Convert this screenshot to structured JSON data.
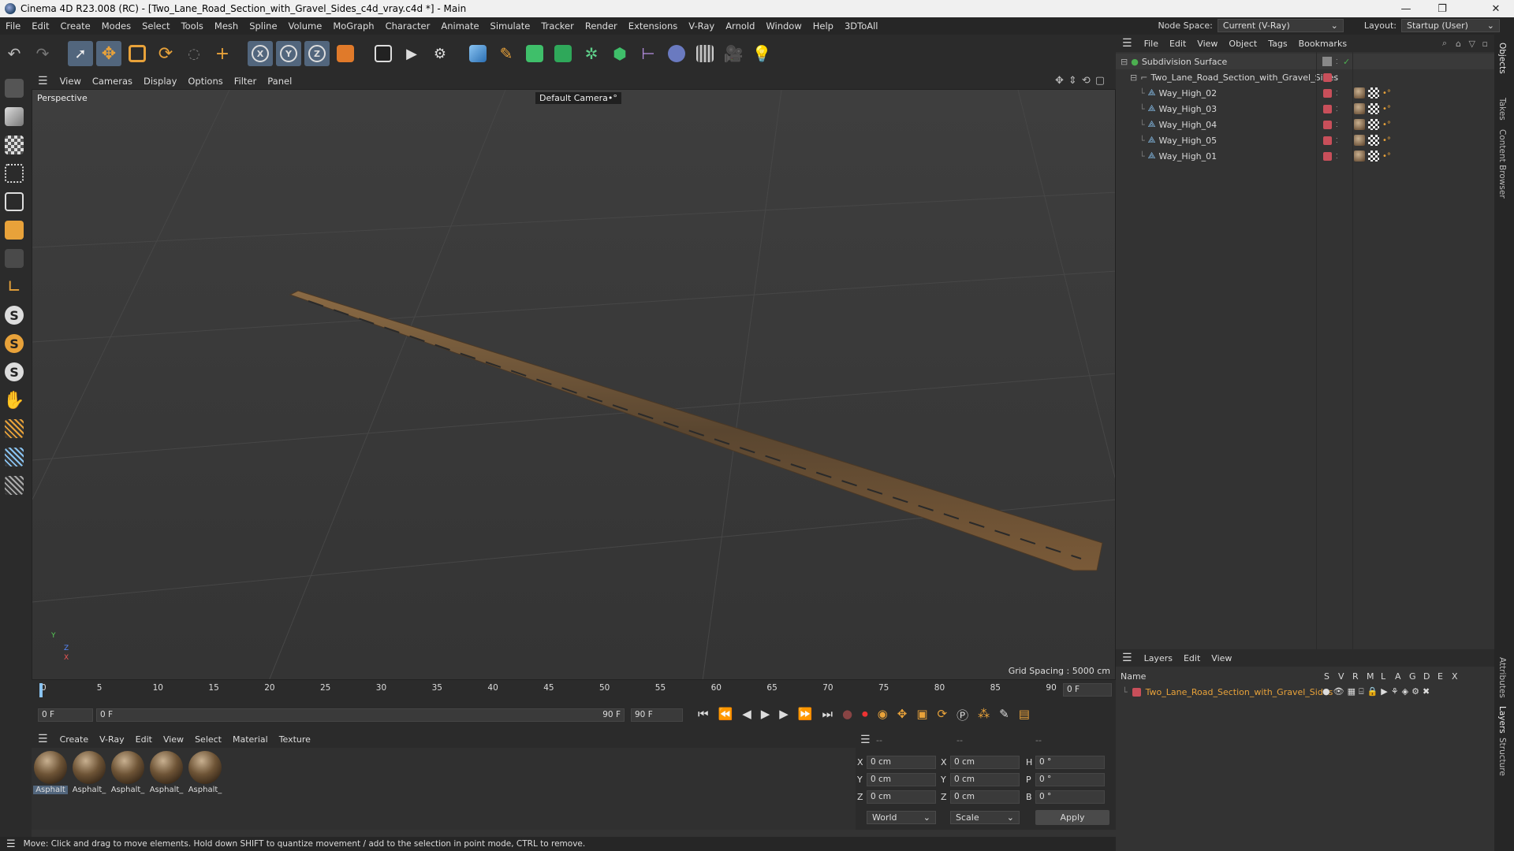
{
  "window": {
    "title": "Cinema 4D R23.008 (RC) - [Two_Lane_Road_Section_with_Gravel_Sides_c4d_vray.c4d *] - Main",
    "controls": [
      "—",
      "❐",
      "✕"
    ]
  },
  "menubar": {
    "items": [
      "File",
      "Edit",
      "Create",
      "Modes",
      "Select",
      "Tools",
      "Mesh",
      "Spline",
      "Volume",
      "MoGraph",
      "Character",
      "Animate",
      "Simulate",
      "Tracker",
      "Render",
      "Extensions",
      "V-Ray",
      "Arnold",
      "Window",
      "Help",
      "3DToAll"
    ],
    "node_space_label": "Node Space:",
    "node_space_value": "Current (V-Ray)",
    "layout_label": "Layout:",
    "layout_value": "Startup (User)"
  },
  "toolbar": {
    "icons": [
      "undo-icon",
      "redo-icon",
      "select-icon",
      "move-icon",
      "scale-icon",
      "rotate-icon",
      "live-select-icon",
      "transform-icon",
      "x-axis-icon",
      "y-axis-icon",
      "z-axis-icon",
      "coord-system-icon",
      "render-region-icon",
      "render-view-icon",
      "render-settings-icon",
      "cube-icon",
      "pen-icon",
      "subdivision-icon",
      "extrude-icon",
      "cloner-icon",
      "mograph-icon",
      "deformer-icon",
      "spline-tool-icon",
      "floor-icon",
      "camera-icon",
      "light-icon"
    ],
    "axis_labels": {
      "x": "X",
      "y": "Y",
      "z": "Z"
    }
  },
  "left_tools": {
    "icons": [
      "make-editable-icon",
      "model-mode-icon",
      "texture-mode-icon",
      "points-mode-icon",
      "edges-mode-icon",
      "polygons-mode-icon",
      "uv-mode-icon",
      "axis-mode-icon",
      "snap-icon",
      "snap-settings-icon",
      "workplane-icon",
      "magnet-icon",
      "grid-icon",
      "lock-grid-icon",
      "layer-icon"
    ],
    "s_labels": [
      "S",
      "S",
      "S"
    ]
  },
  "viewport": {
    "menu": [
      "View",
      "Cameras",
      "Display",
      "Options",
      "Filter",
      "Panel"
    ],
    "label": "Perspective",
    "camera": "Default Camera",
    "camera_suffix": "•°",
    "grid_spacing": "Grid Spacing : 5000 cm",
    "axis": {
      "y": "Y",
      "z": "Z",
      "x": "X"
    }
  },
  "timeline": {
    "ticks": [
      "0",
      "5",
      "10",
      "15",
      "20",
      "25",
      "30",
      "35",
      "40",
      "45",
      "50",
      "55",
      "60",
      "65",
      "70",
      "75",
      "80",
      "85",
      "90"
    ],
    "current_frame": "0 F",
    "start_field": "0 F",
    "range_start": "0 F",
    "range_end": "90 F",
    "end_field": "90 F"
  },
  "materials": {
    "menu": [
      "Create",
      "V-Ray",
      "Edit",
      "View",
      "Select",
      "Material",
      "Texture"
    ],
    "items": [
      "Asphalt",
      "Asphalt_",
      "Asphalt_",
      "Asphalt_",
      "Asphalt_"
    ]
  },
  "coordinates": {
    "headers": [
      "--",
      "--",
      "--"
    ],
    "rows": [
      {
        "a": "X",
        "av": "0 cm",
        "b": "X",
        "bv": "0 cm",
        "c": "H",
        "cv": "0 °"
      },
      {
        "a": "Y",
        "av": "0 cm",
        "b": "Y",
        "bv": "0 cm",
        "c": "P",
        "cv": "0 °"
      },
      {
        "a": "Z",
        "av": "0 cm",
        "b": "Z",
        "bv": "0 cm",
        "c": "B",
        "cv": "0 °"
      }
    ],
    "world": "World",
    "scale": "Scale",
    "apply": "Apply"
  },
  "objects": {
    "menu": [
      "File",
      "Edit",
      "View",
      "Object",
      "Tags",
      "Bookmarks"
    ],
    "tree": [
      {
        "name": "Subdivision Surface",
        "level": 0
      },
      {
        "name": "Two_Lane_Road_Section_with_Gravel_Sides",
        "level": 1
      },
      {
        "name": "Way_High_02",
        "level": 2
      },
      {
        "name": "Way_High_03",
        "level": 2
      },
      {
        "name": "Way_High_04",
        "level": 2
      },
      {
        "name": "Way_High_05",
        "level": 2
      },
      {
        "name": "Way_High_01",
        "level": 2
      }
    ]
  },
  "layers": {
    "menu": [
      "Layers",
      "Edit",
      "View"
    ],
    "name_header": "Name",
    "flags": [
      "S",
      "V",
      "R",
      "M",
      "L",
      "A",
      "G",
      "D",
      "E",
      "X"
    ],
    "items": [
      {
        "name": "Two_Lane_Road_Section_with_Gravel_Sides",
        "color": "#c84f5a"
      }
    ]
  },
  "side_tabs": [
    "Objects",
    "Takes",
    "Content Browser",
    "Attributes",
    "Layers",
    "Structure"
  ],
  "status": "Move: Click and drag to move elements. Hold down SHIFT to quantize movement / add to the selection in point mode, CTRL to remove.",
  "colors": {
    "accent": "#52667d",
    "layer": "#c84f5a",
    "object_green": "#4caf50"
  }
}
